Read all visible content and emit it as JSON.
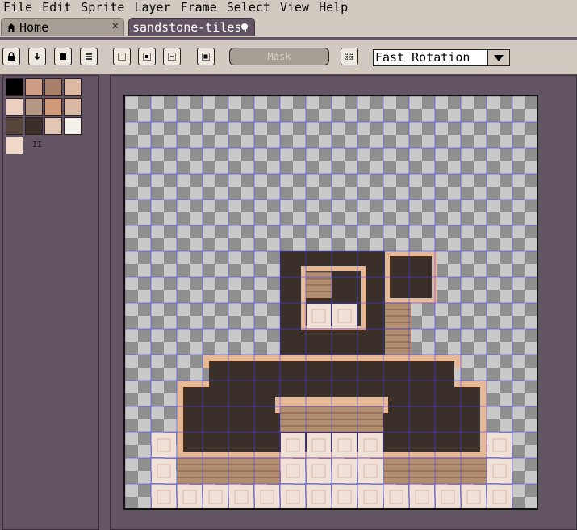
{
  "menu": [
    "File",
    "Edit",
    "Sprite",
    "Layer",
    "Frame",
    "Select",
    "View",
    "Help"
  ],
  "tabs": {
    "home": "Home",
    "file": "sandstone-tiles."
  },
  "toolbar": {
    "mask_label": "Mask",
    "rotation_value": "Fast Rotation"
  },
  "palette": {
    "colors": [
      "#000000",
      "#cd9e84",
      "#a8806a",
      "#ddb9a4",
      "#ecd0c0",
      "#b39884",
      "#d09a7a",
      "#d9b8a4",
      "#56463a",
      "#3b2f2a",
      "#e2c6b4",
      "#f4f0ea",
      "#f0d8c8"
    ],
    "label": "II"
  },
  "icons": {
    "home": "home-icon",
    "close": "close-icon",
    "modified": "modified-dot-icon",
    "lock": "lock-icon",
    "down": "down-arrow-icon",
    "stop": "square-icon",
    "menu": "lines-icon",
    "select1": "marquee-icon",
    "select2": "marquee-filled-icon",
    "select3": "marquee-sub-icon",
    "pivot": "pivot-icon",
    "grid": "grid-icon",
    "dropdown": "chevron-down-icon"
  },
  "colors": {
    "chrome": "#d2cac0",
    "panel": "#625462",
    "grid": "#4040ff",
    "sand_dark": "#3b2f2a",
    "sand_edge": "#e6b896",
    "brick": "#b48e70",
    "tile": "#f0e0d8"
  }
}
